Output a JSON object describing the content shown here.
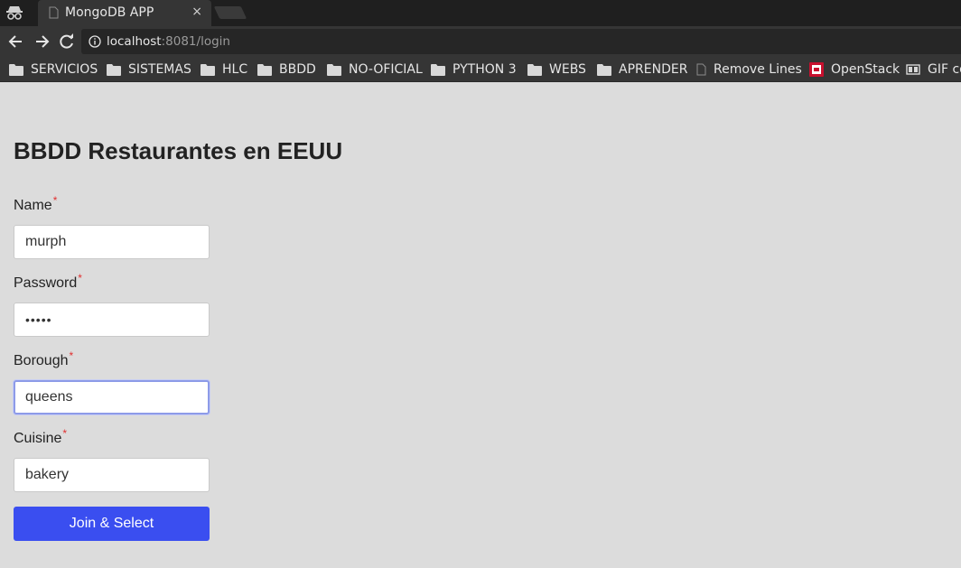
{
  "browser": {
    "tab_title": "MongoDB APP",
    "tab_close": "×",
    "url_host": "localhost",
    "url_path": ":8081/login",
    "bookmarks": [
      "SERVICIOS",
      "SISTEMAS",
      "HLC",
      "BBDD",
      "NO-OFICIAL",
      "PYTHON 3",
      "WEBS",
      "APRENDER",
      "Remove Lines",
      "OpenStack",
      "GIF co"
    ]
  },
  "form": {
    "title": "BBDD Restaurantes en EEUU",
    "required_mark": "*",
    "name_label": "Name",
    "name_value": "murph",
    "password_label": "Password",
    "password_value": "•••••",
    "borough_label": "Borough",
    "borough_value": "queens",
    "cuisine_label": "Cuisine",
    "cuisine_value": "bakery",
    "submit_label": "Join & Select"
  },
  "colors": {
    "accent": "#3a4ef0",
    "required": "#e03030",
    "background": "#dcdcdc"
  }
}
